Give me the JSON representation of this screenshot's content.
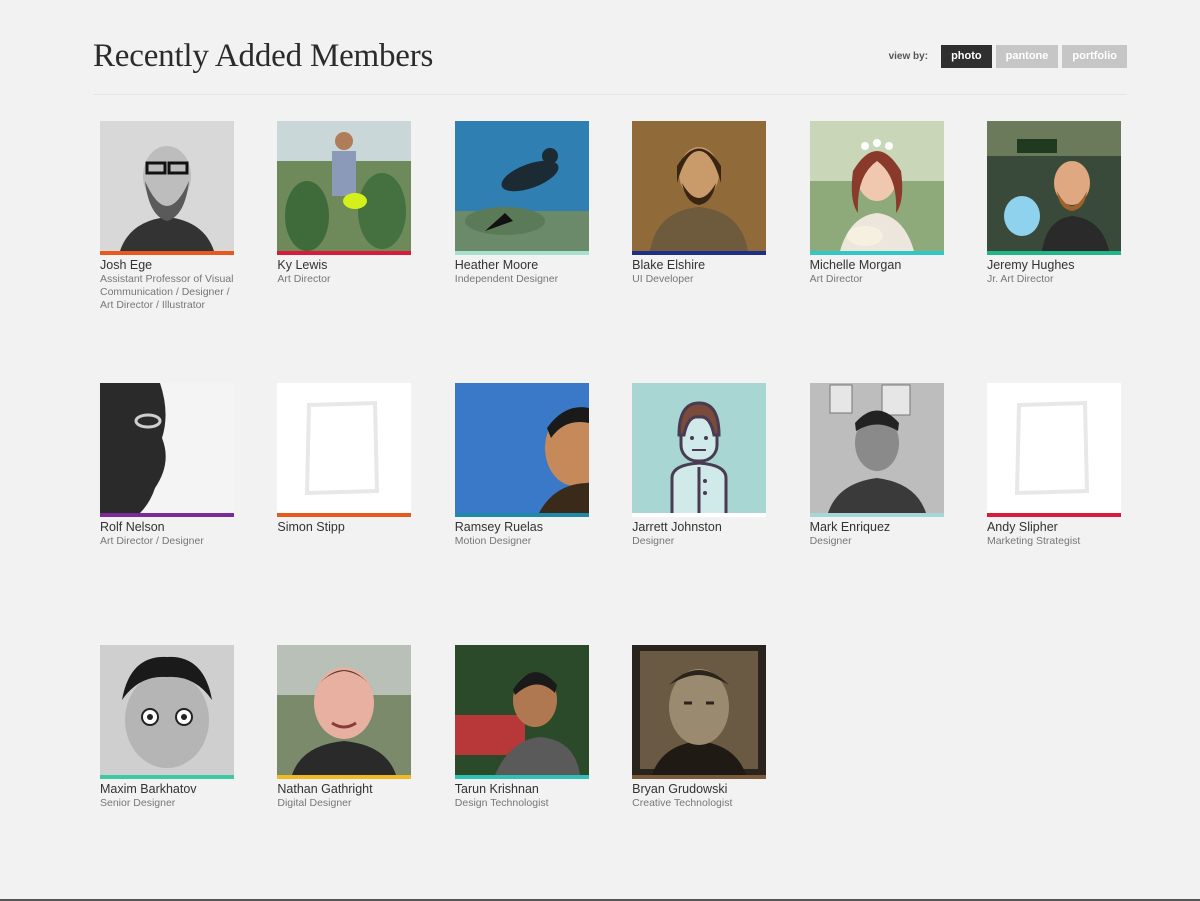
{
  "header": {
    "title": "Recently Added Members",
    "view_by_label": "view by:",
    "view_options": [
      "photo",
      "pantone",
      "portfolio"
    ],
    "active_view": "photo"
  },
  "members": [
    {
      "name": "Josh Ege",
      "title": "Assistant Professor of Visual Communication / Designer / Art Director / Illustrator",
      "accent": "#e8591f"
    },
    {
      "name": "Ky Lewis",
      "title": "Art Director",
      "accent": "#d81b3b"
    },
    {
      "name": "Heather Moore",
      "title": "Independent Designer",
      "accent": "#a8e0cf"
    },
    {
      "name": "Blake Elshire",
      "title": "UI Developer",
      "accent": "#1e2f8a"
    },
    {
      "name": "Michelle Morgan",
      "title": "Art Director",
      "accent": "#34c7c7"
    },
    {
      "name": "Jeremy Hughes",
      "title": "Jr. Art Director",
      "accent": "#22b58a"
    },
    {
      "name": "Rolf Nelson",
      "title": "Art Director / Designer",
      "accent": "#7b2a9a"
    },
    {
      "name": "Simon Stipp",
      "title": "",
      "accent": "#e8591f"
    },
    {
      "name": "Ramsey Ruelas",
      "title": "Motion Designer",
      "accent": "#1f8aa8"
    },
    {
      "name": "Jarrett Johnston",
      "title": "Designer",
      "accent": "#ffffff"
    },
    {
      "name": "Mark Enriquez",
      "title": "Designer",
      "accent": "#a7d6d6"
    },
    {
      "name": "Andy Slipher",
      "title": "Marketing Strategist",
      "accent": "#d81b3b"
    },
    {
      "name": "Maxim Barkhatov",
      "title": "Senior Designer",
      "accent": "#3cc9a4"
    },
    {
      "name": "Nathan Gathright",
      "title": "Digital Designer",
      "accent": "#f2b824"
    },
    {
      "name": "Tarun Krishnan",
      "title": "Design Technologist",
      "accent": "#2fc1b8"
    },
    {
      "name": "Bryan Grudowski",
      "title": "Creative Technologist",
      "accent": "#7a5a3a"
    }
  ]
}
